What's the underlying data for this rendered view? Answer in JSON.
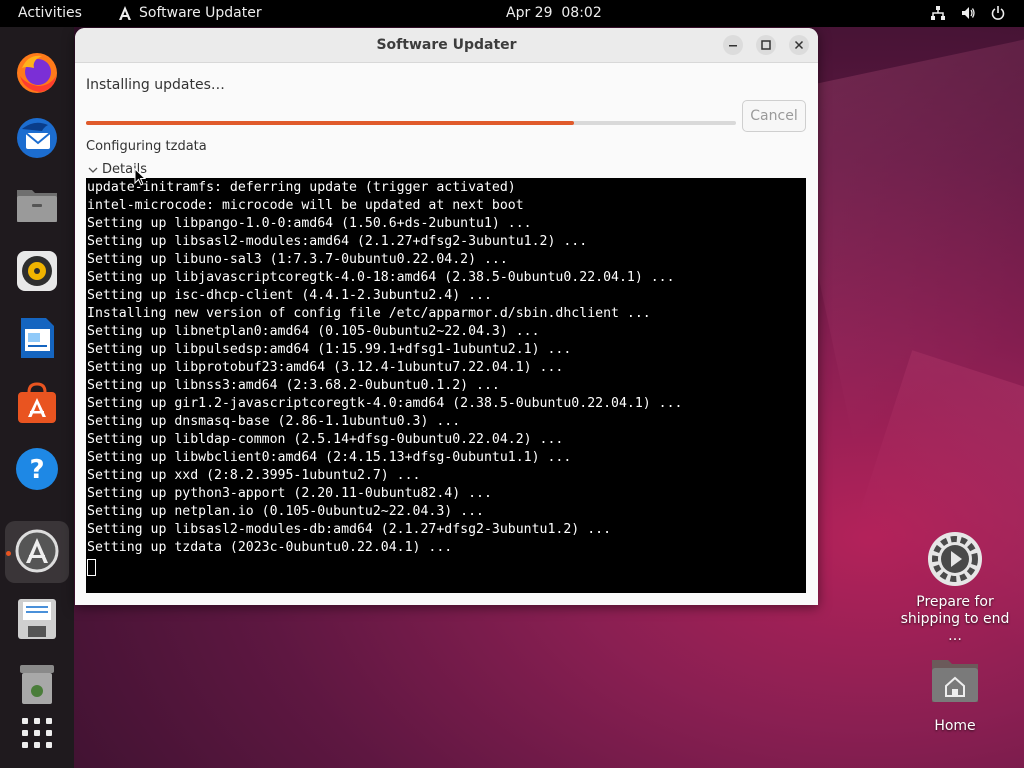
{
  "topbar": {
    "activities": "Activities",
    "app_name": "Software Updater",
    "clock": "Apr 29  08:02",
    "tray_icons": [
      "network-icon",
      "volume-icon",
      "power-icon"
    ]
  },
  "dock": {
    "items": [
      {
        "name": "firefox",
        "icon": "firefox-icon"
      },
      {
        "name": "thunderbird",
        "icon": "thunderbird-icon"
      },
      {
        "name": "files",
        "icon": "files-icon"
      },
      {
        "name": "rhythmbox",
        "icon": "rhythmbox-icon"
      },
      {
        "name": "writer",
        "icon": "libreoffice-writer-icon"
      },
      {
        "name": "app-center",
        "icon": "software-store-icon"
      },
      {
        "name": "help",
        "icon": "help-icon"
      },
      {
        "name": "software-updater",
        "icon": "software-updater-icon",
        "active": true
      },
      {
        "name": "save",
        "icon": "floppy-icon"
      },
      {
        "name": "trash",
        "icon": "trash-icon"
      },
      {
        "name": "show-apps",
        "icon": "app-grid-icon"
      }
    ]
  },
  "window": {
    "title": "Software Updater",
    "status": "Installing updates…",
    "progress_percent": 75,
    "cancel_label": "Cancel",
    "configuring": "Configuring tzdata",
    "details_label": "Details",
    "terminal_lines": [
      "update-initramfs: deferring update (trigger activated)",
      "intel-microcode: microcode will be updated at next boot",
      "Setting up libpango-1.0-0:amd64 (1.50.6+ds-2ubuntu1) ...",
      "Setting up libsasl2-modules:amd64 (2.1.27+dfsg2-3ubuntu1.2) ...",
      "Setting up libuno-sal3 (1:7.3.7-0ubuntu0.22.04.2) ...",
      "Setting up libjavascriptcoregtk-4.0-18:amd64 (2.38.5-0ubuntu0.22.04.1) ...",
      "Setting up isc-dhcp-client (4.4.1-2.3ubuntu2.4) ...",
      "Installing new version of config file /etc/apparmor.d/sbin.dhclient ...",
      "Setting up libnetplan0:amd64 (0.105-0ubuntu2~22.04.3) ...",
      "Setting up libpulsedsp:amd64 (1:15.99.1+dfsg1-1ubuntu2.1) ...",
      "Setting up libprotobuf23:amd64 (3.12.4-1ubuntu7.22.04.1) ...",
      "Setting up libnss3:amd64 (2:3.68.2-0ubuntu0.1.2) ...",
      "Setting up gir1.2-javascriptcoregtk-4.0:amd64 (2.38.5-0ubuntu0.22.04.1) ...",
      "Setting up dnsmasq-base (2.86-1.1ubuntu0.3) ...",
      "Setting up libldap-common (2.5.14+dfsg-0ubuntu0.22.04.2) ...",
      "Setting up libwbclient0:amd64 (2:4.15.13+dfsg-0ubuntu1.1) ...",
      "Setting up xxd (2:8.2.3995-1ubuntu2.7) ...",
      "Setting up python3-apport (2.20.11-0ubuntu82.4) ...",
      "Setting up netplan.io (0.105-0ubuntu2~22.04.3) ...",
      "Setting up libsasl2-modules-db:amd64 (2.1.27+dfsg2-3ubuntu1.2) ...",
      "Setting up tzdata (2023c-0ubuntu0.22.04.1) ..."
    ]
  },
  "desktop": {
    "shortcut_label": "Prepare for\nshipping to end …",
    "home_label": "Home"
  },
  "colors": {
    "accent": "#e95420",
    "progress": "#e05a2b",
    "terminal_bg": "#000000"
  }
}
